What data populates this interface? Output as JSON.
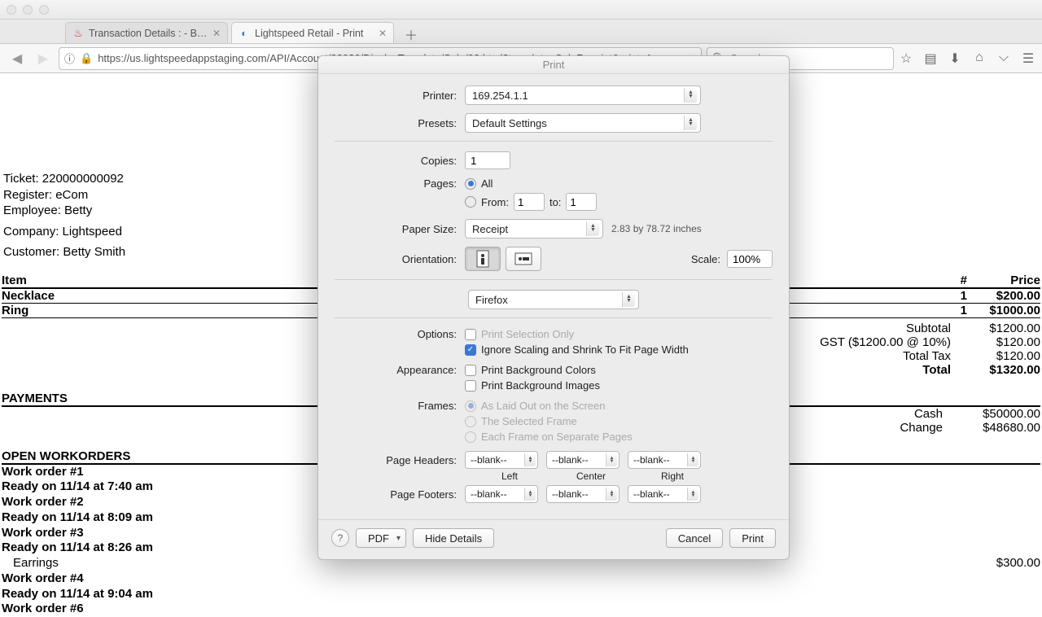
{
  "browser": {
    "tabs": [
      {
        "title": "Transaction Details : - Blad…",
        "favicon": "🔥"
      },
      {
        "title": "Lightspeed Retail - Print",
        "favicon": "◐"
      }
    ],
    "url": "https://us.lightspeedappstaging.com/API/Account/83936/DisplayTemplate/Sale/92.html?template=SaleReceipt&print=1",
    "search_placeholder": "Search"
  },
  "receipt": {
    "ticket_label": "Ticket: 220000000092",
    "register_label": "Register: eCom",
    "employee_label": "Employee: Betty",
    "company_label": "Company: Lightspeed",
    "customer_label": "Customer: Betty Smith",
    "headers": {
      "item": "Item",
      "qty": "#",
      "price": "Price"
    },
    "items": [
      {
        "name": "Necklace",
        "qty": "1",
        "price": "$200.00"
      },
      {
        "name": "Ring",
        "qty": "1",
        "price": "$1000.00"
      }
    ],
    "subtotal_label": "Subtotal",
    "subtotal": "$1200.00",
    "gst_label": "GST ($1200.00 @ 10%)",
    "gst": "$120.00",
    "tax_label": "Total Tax",
    "tax": "$120.00",
    "total_label": "Total",
    "total": "$1320.00",
    "payments_header": "PAYMENTS",
    "cash_label": "Cash",
    "cash": "$50000.00",
    "change_label": "Change",
    "change": "$48680.00",
    "wo_header": "OPEN WORKORDERS",
    "workorders": [
      {
        "title": "Work order #1",
        "ready": "Ready on 11/14 at 7:40 am"
      },
      {
        "title": "Work order #2",
        "ready": "Ready on 11/14 at 8:09 am"
      },
      {
        "title": "Work order #3",
        "ready": "Ready on 11/14 at 8:26 am",
        "item": "Earrings",
        "price": "$300.00"
      },
      {
        "title": "Work order #4",
        "ready": "Ready on 11/14 at 9:04 am"
      },
      {
        "title": "Work order #6",
        "ready": ""
      }
    ]
  },
  "print": {
    "title": "Print",
    "printer_label": "Printer:",
    "printer": "169.254.1.1",
    "presets_label": "Presets:",
    "presets": "Default Settings",
    "copies_label": "Copies:",
    "copies": "1",
    "pages_label": "Pages:",
    "pages_all": "All",
    "pages_from_label": "From:",
    "pages_from": "1",
    "pages_to_label": "to:",
    "pages_to": "1",
    "papersize_label": "Paper Size:",
    "papersize": "Receipt",
    "papersize_dim": "2.83 by 78.72 inches",
    "orientation_label": "Orientation:",
    "scale_label": "Scale:",
    "scale": "100%",
    "app_select": "Firefox",
    "options_label": "Options:",
    "opt_selection": "Print Selection Only",
    "opt_ignore": "Ignore Scaling and Shrink To Fit Page Width",
    "appearance_label": "Appearance:",
    "app_bgcolor": "Print Background Colors",
    "app_bgimg": "Print Background Images",
    "frames_label": "Frames:",
    "frames_layout": "As Laid Out on the Screen",
    "frames_selected": "The Selected Frame",
    "frames_separate": "Each Frame on Separate Pages",
    "pageheaders_label": "Page Headers:",
    "pagefooters_label": "Page Footers:",
    "blank": "--blank--",
    "hf_left": "Left",
    "hf_center": "Center",
    "hf_right": "Right",
    "pdf": "PDF",
    "hide": "Hide Details",
    "cancel": "Cancel",
    "print_btn": "Print"
  }
}
